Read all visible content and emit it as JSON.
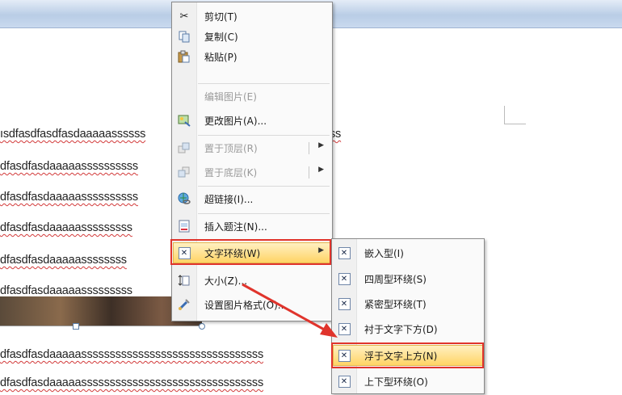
{
  "document": {
    "lines": [
      "ısdfasdfasdfasdaaaaassssss",
      "dfasdfasdaaaaassssssssss",
      "dfasdfasdaaaaassssssssss",
      "dfasdfasdaaaaasssssssss",
      "dfasdfasdaaaaassssssss",
      "dfasdfasdaaaaasssssssss",
      "dfasdfasdaaaaassssssssssssssssssssssssssssssss",
      "dfasdfasdaaaaassssssssssssssssssssssssssssssss"
    ],
    "line1_tail": "ss"
  },
  "context_menu": {
    "items": [
      {
        "icon": "scissors-icon",
        "label": "剪切(T)",
        "enabled": true
      },
      {
        "icon": "copy-icon",
        "label": "复制(C)",
        "enabled": true
      },
      {
        "icon": "paste-icon",
        "label": "粘贴(P)",
        "enabled": true
      },
      {
        "icon": "",
        "label": "编辑图片(E)",
        "enabled": false
      },
      {
        "icon": "change-picture-icon",
        "label": "更改图片(A)...",
        "enabled": true
      },
      {
        "icon": "bring-to-front-icon",
        "label": "置于顶层(R)",
        "enabled": false,
        "submenu": true
      },
      {
        "icon": "send-to-back-icon",
        "label": "置于底层(K)",
        "enabled": false,
        "submenu": true
      },
      {
        "icon": "hyperlink-icon",
        "label": "超链接(I)...",
        "enabled": true
      },
      {
        "icon": "insert-caption-icon",
        "label": "插入题注(N)...",
        "enabled": true
      },
      {
        "icon": "text-wrap-icon",
        "label": "文字环绕(W)",
        "enabled": true,
        "submenu": true,
        "highlighted": true
      },
      {
        "icon": "size-icon",
        "label": "大小(Z)...",
        "enabled": true
      },
      {
        "icon": "format-picture-icon",
        "label": "设置图片格式(O)...",
        "enabled": true
      }
    ]
  },
  "submenu": {
    "items": [
      {
        "icon": "inline-wrap-icon",
        "label": "嵌入型(I)"
      },
      {
        "icon": "square-wrap-icon",
        "label": "四周型环绕(S)"
      },
      {
        "icon": "tight-wrap-icon",
        "label": "紧密型环绕(T)"
      },
      {
        "icon": "behind-text-icon",
        "label": "衬于文字下方(D)"
      },
      {
        "icon": "in-front-of-text-icon",
        "label": "浮于文字上方(N)",
        "highlighted": true
      },
      {
        "icon": "top-bottom-wrap-icon",
        "label": "上下型环绕(O)"
      }
    ]
  },
  "colors": {
    "highlight_box": "#e0342c",
    "menu_hover": "#ffd465",
    "spellcheck_underline": "#d23a3a"
  }
}
